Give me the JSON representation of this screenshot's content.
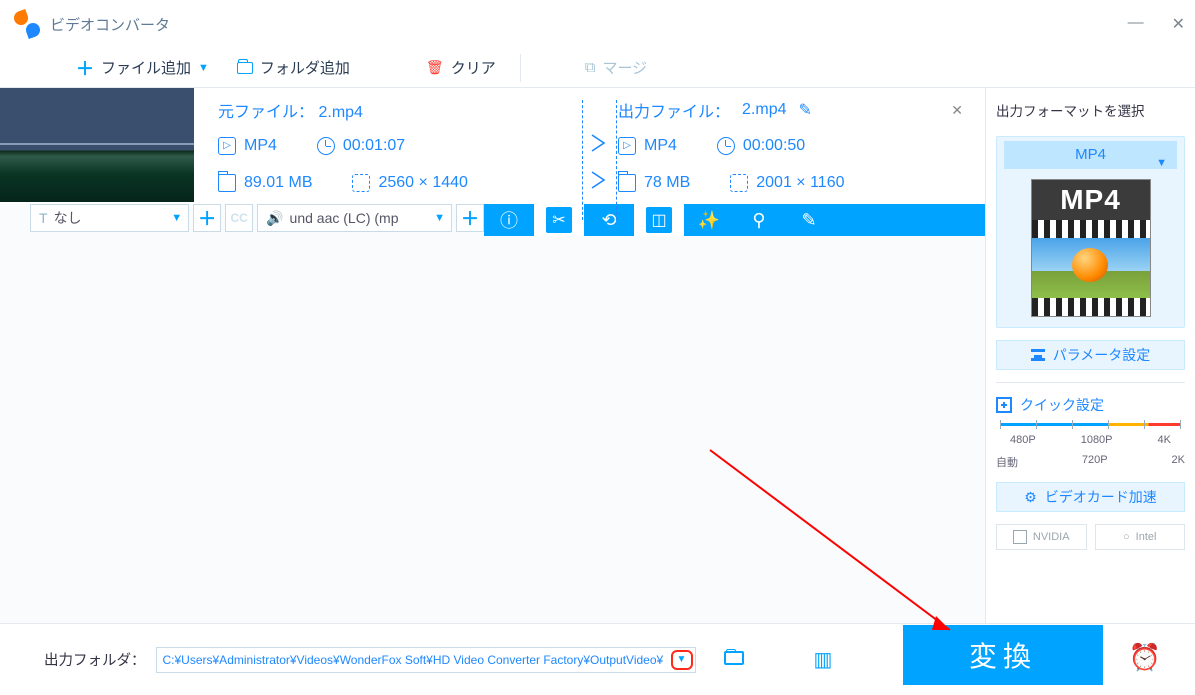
{
  "window": {
    "title": "ビデオコンバータ",
    "minimize": "—",
    "close": "✕"
  },
  "toolbar": {
    "add_file": "ファイル追加",
    "add_folder": "フォルダ追加",
    "clear": "クリア",
    "merge": "マージ"
  },
  "item": {
    "src_label": "元ファイル：",
    "src_name": "2.mp4",
    "out_label": "出力ファイル：",
    "out_name": "2.mp4",
    "src": {
      "container": "MP4",
      "duration": "00:01:07",
      "size": "89.01 MB",
      "resolution": "2560 × 1440"
    },
    "out": {
      "container": "MP4",
      "duration": "00:00:50",
      "size": "78 MB",
      "resolution": "2001 × 1160"
    },
    "close_x": "✕"
  },
  "action": {
    "subtitle_none": "なし",
    "audio_track": "und aac (LC) (mp",
    "info": "ⓘ",
    "cut": "✂",
    "rotate": "⟲",
    "crop": "◫",
    "effect": "✨",
    "watermark": "⚲",
    "edit": "✎"
  },
  "side": {
    "title": "出力フォーマットを選択",
    "format": "MP4",
    "format_big": "MP4",
    "parameter": "パラメータ設定",
    "quick": "クイック設定",
    "scale_row1": [
      "480P",
      "1080P",
      "4K"
    ],
    "scale_row2": [
      "自動",
      "720P",
      "2K"
    ],
    "gpu_accel": "ビデオカード加速",
    "gpu_chips": [
      "NVIDIA",
      "Intel"
    ]
  },
  "footer": {
    "out_folder_label": "出力フォルダ：",
    "out_folder_path": "C:¥Users¥Administrator¥Videos¥WonderFox Soft¥HD Video Converter Factory¥OutputVideo¥",
    "convert": "変換"
  }
}
